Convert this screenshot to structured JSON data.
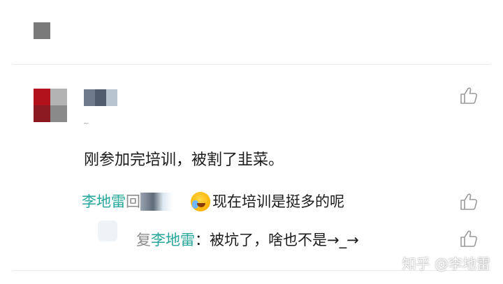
{
  "comment": {
    "text": "刚参加完培训，被割了韭菜。"
  },
  "reply": {
    "author": "李地雷",
    "reply_label": "回复",
    "text": "现在培训是挺多的呢"
  },
  "sub_reply": {
    "reply_label": "复",
    "author": "李地雷",
    "separator": "：",
    "text": "被坑了，啥也不是→_→"
  },
  "watermark": "知乎 @李地雷",
  "icons": {
    "like": "thumbs-up-icon",
    "emoji": "laughing-tears-emoji-icon"
  },
  "colors": {
    "author": "#26a69a",
    "muted": "#8c8c8c",
    "avatar": [
      "#b1121c",
      "#b3b3b3",
      "#8b1a22",
      "#8a8a8a"
    ],
    "name_blur": [
      "#6c7a8c",
      "#4e5c6e",
      "#b8c4cf"
    ]
  }
}
